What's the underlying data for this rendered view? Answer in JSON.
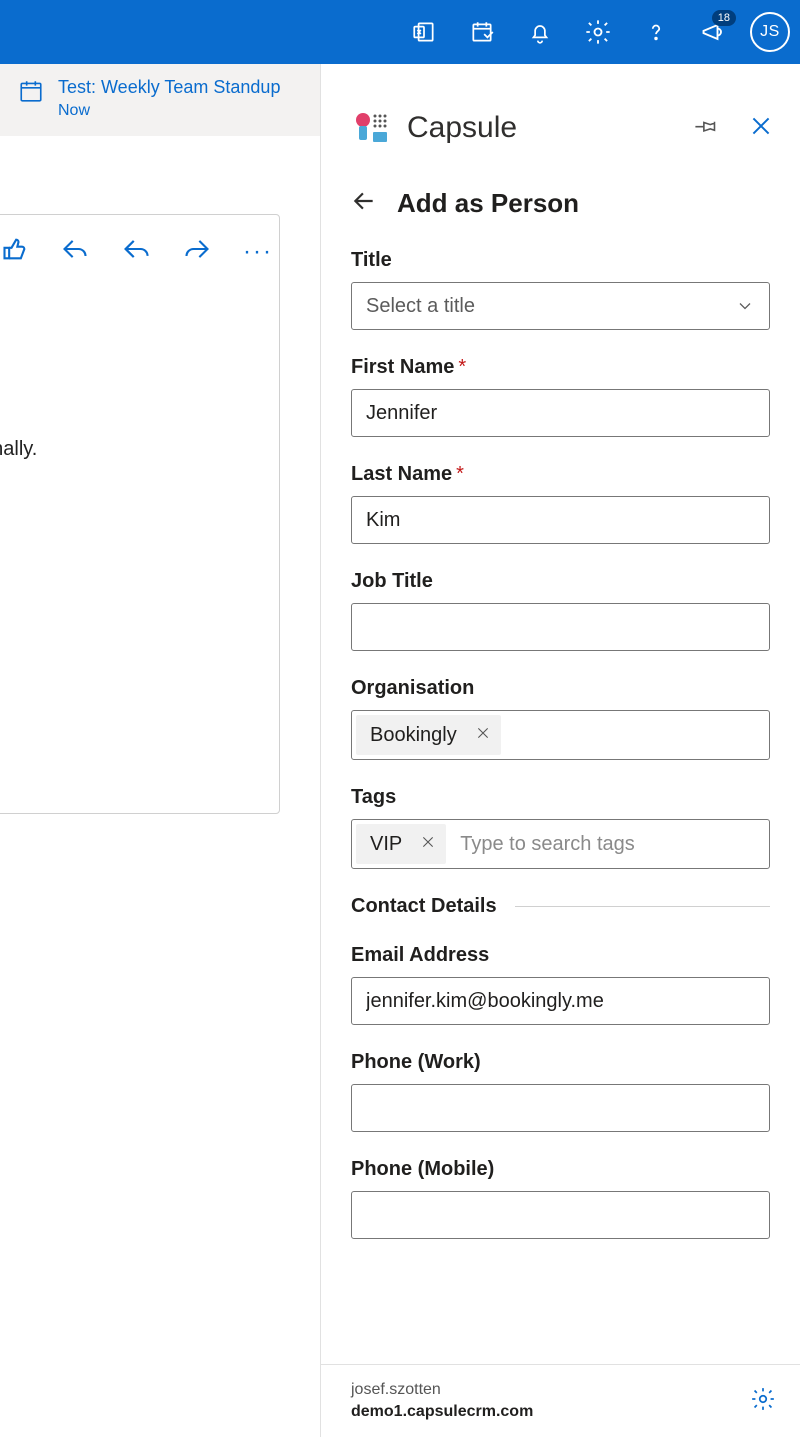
{
  "appbar": {
    "badge_count": "18",
    "avatar_initials": "JS"
  },
  "event": {
    "title": "Test: Weekly Team Standup",
    "when": "Now"
  },
  "mail": {
    "snippet": "onally."
  },
  "panel": {
    "brand": "Capsule",
    "subhead": "Add as Person"
  },
  "form": {
    "title_label": "Title",
    "title_placeholder": "Select a title",
    "first_name_label": "First Name",
    "first_name_value": "Jennifer",
    "last_name_label": "Last Name",
    "last_name_value": "Kim",
    "job_title_label": "Job Title",
    "job_title_value": "",
    "org_label": "Organisation",
    "org_chip": "Bookingly",
    "tags_label": "Tags",
    "tags_chip": "VIP",
    "tags_placeholder": "Type to search tags",
    "contact_section": "Contact Details",
    "email_label": "Email Address",
    "email_value": "jennifer.kim@bookingly.me",
    "phone_work_label": "Phone (Work)",
    "phone_work_value": "",
    "phone_mobile_label": "Phone (Mobile)",
    "phone_mobile_value": ""
  },
  "footer": {
    "user": "josef.szotten",
    "domain": "demo1.capsulecrm.com"
  }
}
